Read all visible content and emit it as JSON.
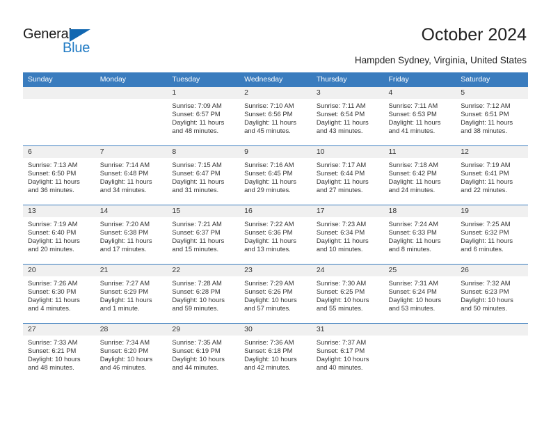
{
  "brand": {
    "name_part1": "General",
    "name_part2": "Blue",
    "accent_color": "#1f7ac4",
    "triangle_color": "#1167b1"
  },
  "header": {
    "month_title": "October 2024",
    "location": "Hampden Sydney, Virginia, United States"
  },
  "calendar": {
    "header_bg": "#3a7cbe",
    "daynum_bg": "#f0f0f0",
    "weekday_headers": [
      "Sunday",
      "Monday",
      "Tuesday",
      "Wednesday",
      "Thursday",
      "Friday",
      "Saturday"
    ],
    "weeks": [
      [
        {
          "day": "",
          "sunrise": "",
          "sunset": "",
          "daylight_line1": "",
          "daylight_line2": ""
        },
        {
          "day": "",
          "sunrise": "",
          "sunset": "",
          "daylight_line1": "",
          "daylight_line2": ""
        },
        {
          "day": "1",
          "sunrise": "Sunrise: 7:09 AM",
          "sunset": "Sunset: 6:57 PM",
          "daylight_line1": "Daylight: 11 hours",
          "daylight_line2": "and 48 minutes."
        },
        {
          "day": "2",
          "sunrise": "Sunrise: 7:10 AM",
          "sunset": "Sunset: 6:56 PM",
          "daylight_line1": "Daylight: 11 hours",
          "daylight_line2": "and 45 minutes."
        },
        {
          "day": "3",
          "sunrise": "Sunrise: 7:11 AM",
          "sunset": "Sunset: 6:54 PM",
          "daylight_line1": "Daylight: 11 hours",
          "daylight_line2": "and 43 minutes."
        },
        {
          "day": "4",
          "sunrise": "Sunrise: 7:11 AM",
          "sunset": "Sunset: 6:53 PM",
          "daylight_line1": "Daylight: 11 hours",
          "daylight_line2": "and 41 minutes."
        },
        {
          "day": "5",
          "sunrise": "Sunrise: 7:12 AM",
          "sunset": "Sunset: 6:51 PM",
          "daylight_line1": "Daylight: 11 hours",
          "daylight_line2": "and 38 minutes."
        }
      ],
      [
        {
          "day": "6",
          "sunrise": "Sunrise: 7:13 AM",
          "sunset": "Sunset: 6:50 PM",
          "daylight_line1": "Daylight: 11 hours",
          "daylight_line2": "and 36 minutes."
        },
        {
          "day": "7",
          "sunrise": "Sunrise: 7:14 AM",
          "sunset": "Sunset: 6:48 PM",
          "daylight_line1": "Daylight: 11 hours",
          "daylight_line2": "and 34 minutes."
        },
        {
          "day": "8",
          "sunrise": "Sunrise: 7:15 AM",
          "sunset": "Sunset: 6:47 PM",
          "daylight_line1": "Daylight: 11 hours",
          "daylight_line2": "and 31 minutes."
        },
        {
          "day": "9",
          "sunrise": "Sunrise: 7:16 AM",
          "sunset": "Sunset: 6:45 PM",
          "daylight_line1": "Daylight: 11 hours",
          "daylight_line2": "and 29 minutes."
        },
        {
          "day": "10",
          "sunrise": "Sunrise: 7:17 AM",
          "sunset": "Sunset: 6:44 PM",
          "daylight_line1": "Daylight: 11 hours",
          "daylight_line2": "and 27 minutes."
        },
        {
          "day": "11",
          "sunrise": "Sunrise: 7:18 AM",
          "sunset": "Sunset: 6:42 PM",
          "daylight_line1": "Daylight: 11 hours",
          "daylight_line2": "and 24 minutes."
        },
        {
          "day": "12",
          "sunrise": "Sunrise: 7:19 AM",
          "sunset": "Sunset: 6:41 PM",
          "daylight_line1": "Daylight: 11 hours",
          "daylight_line2": "and 22 minutes."
        }
      ],
      [
        {
          "day": "13",
          "sunrise": "Sunrise: 7:19 AM",
          "sunset": "Sunset: 6:40 PM",
          "daylight_line1": "Daylight: 11 hours",
          "daylight_line2": "and 20 minutes."
        },
        {
          "day": "14",
          "sunrise": "Sunrise: 7:20 AM",
          "sunset": "Sunset: 6:38 PM",
          "daylight_line1": "Daylight: 11 hours",
          "daylight_line2": "and 17 minutes."
        },
        {
          "day": "15",
          "sunrise": "Sunrise: 7:21 AM",
          "sunset": "Sunset: 6:37 PM",
          "daylight_line1": "Daylight: 11 hours",
          "daylight_line2": "and 15 minutes."
        },
        {
          "day": "16",
          "sunrise": "Sunrise: 7:22 AM",
          "sunset": "Sunset: 6:36 PM",
          "daylight_line1": "Daylight: 11 hours",
          "daylight_line2": "and 13 minutes."
        },
        {
          "day": "17",
          "sunrise": "Sunrise: 7:23 AM",
          "sunset": "Sunset: 6:34 PM",
          "daylight_line1": "Daylight: 11 hours",
          "daylight_line2": "and 10 minutes."
        },
        {
          "day": "18",
          "sunrise": "Sunrise: 7:24 AM",
          "sunset": "Sunset: 6:33 PM",
          "daylight_line1": "Daylight: 11 hours",
          "daylight_line2": "and 8 minutes."
        },
        {
          "day": "19",
          "sunrise": "Sunrise: 7:25 AM",
          "sunset": "Sunset: 6:32 PM",
          "daylight_line1": "Daylight: 11 hours",
          "daylight_line2": "and 6 minutes."
        }
      ],
      [
        {
          "day": "20",
          "sunrise": "Sunrise: 7:26 AM",
          "sunset": "Sunset: 6:30 PM",
          "daylight_line1": "Daylight: 11 hours",
          "daylight_line2": "and 4 minutes."
        },
        {
          "day": "21",
          "sunrise": "Sunrise: 7:27 AM",
          "sunset": "Sunset: 6:29 PM",
          "daylight_line1": "Daylight: 11 hours",
          "daylight_line2": "and 1 minute."
        },
        {
          "day": "22",
          "sunrise": "Sunrise: 7:28 AM",
          "sunset": "Sunset: 6:28 PM",
          "daylight_line1": "Daylight: 10 hours",
          "daylight_line2": "and 59 minutes."
        },
        {
          "day": "23",
          "sunrise": "Sunrise: 7:29 AM",
          "sunset": "Sunset: 6:26 PM",
          "daylight_line1": "Daylight: 10 hours",
          "daylight_line2": "and 57 minutes."
        },
        {
          "day": "24",
          "sunrise": "Sunrise: 7:30 AM",
          "sunset": "Sunset: 6:25 PM",
          "daylight_line1": "Daylight: 10 hours",
          "daylight_line2": "and 55 minutes."
        },
        {
          "day": "25",
          "sunrise": "Sunrise: 7:31 AM",
          "sunset": "Sunset: 6:24 PM",
          "daylight_line1": "Daylight: 10 hours",
          "daylight_line2": "and 53 minutes."
        },
        {
          "day": "26",
          "sunrise": "Sunrise: 7:32 AM",
          "sunset": "Sunset: 6:23 PM",
          "daylight_line1": "Daylight: 10 hours",
          "daylight_line2": "and 50 minutes."
        }
      ],
      [
        {
          "day": "27",
          "sunrise": "Sunrise: 7:33 AM",
          "sunset": "Sunset: 6:21 PM",
          "daylight_line1": "Daylight: 10 hours",
          "daylight_line2": "and 48 minutes."
        },
        {
          "day": "28",
          "sunrise": "Sunrise: 7:34 AM",
          "sunset": "Sunset: 6:20 PM",
          "daylight_line1": "Daylight: 10 hours",
          "daylight_line2": "and 46 minutes."
        },
        {
          "day": "29",
          "sunrise": "Sunrise: 7:35 AM",
          "sunset": "Sunset: 6:19 PM",
          "daylight_line1": "Daylight: 10 hours",
          "daylight_line2": "and 44 minutes."
        },
        {
          "day": "30",
          "sunrise": "Sunrise: 7:36 AM",
          "sunset": "Sunset: 6:18 PM",
          "daylight_line1": "Daylight: 10 hours",
          "daylight_line2": "and 42 minutes."
        },
        {
          "day": "31",
          "sunrise": "Sunrise: 7:37 AM",
          "sunset": "Sunset: 6:17 PM",
          "daylight_line1": "Daylight: 10 hours",
          "daylight_line2": "and 40 minutes."
        },
        {
          "day": "",
          "sunrise": "",
          "sunset": "",
          "daylight_line1": "",
          "daylight_line2": ""
        },
        {
          "day": "",
          "sunrise": "",
          "sunset": "",
          "daylight_line1": "",
          "daylight_line2": ""
        }
      ]
    ]
  }
}
